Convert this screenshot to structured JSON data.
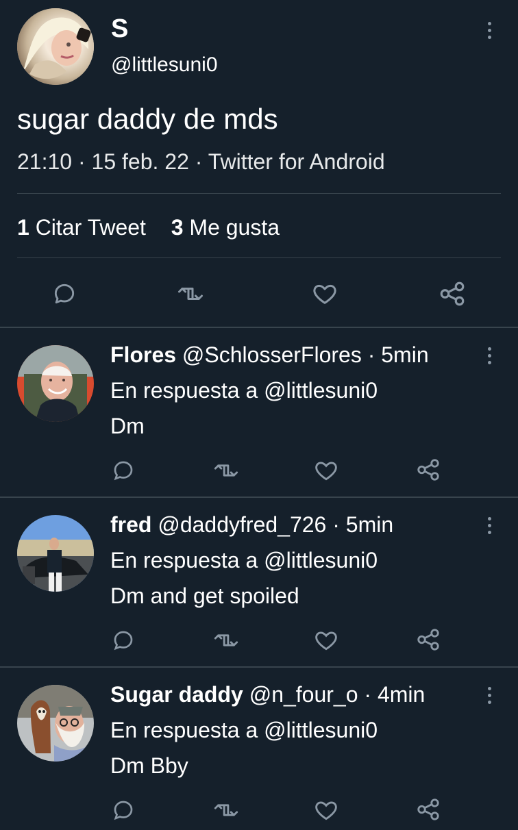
{
  "main_tweet": {
    "name": "S",
    "handle": "@littlesuni0",
    "text": "sugar daddy de mds",
    "meta": "21:10 · 15 feb. 22 · Twitter for Android",
    "stats": {
      "quote_count": "1",
      "quote_label": "Citar Tweet",
      "like_count": "3",
      "like_label": "Me gusta"
    }
  },
  "replies": [
    {
      "name": "Flores",
      "handle": "@SchlosserFlores",
      "time": "· 5min",
      "reply_to": "En respuesta a @littlesuni0",
      "text": "Dm"
    },
    {
      "name": "fred",
      "handle": "@daddyfred_726",
      "time": "· 5min",
      "reply_to": "En respuesta a @littlesuni0",
      "text": "Dm and get spoiled"
    },
    {
      "name": "Sugar daddy",
      "handle": "@n_four_o",
      "time": "· 4min",
      "reply_to": "En respuesta a @littlesuni0",
      "text": "Dm Bby"
    }
  ],
  "colors": {
    "background": "#15202b",
    "divider": "#38444d",
    "icon": "#8b98a5",
    "text": "#ffffff"
  },
  "icons": {
    "reply": "reply-icon",
    "retweet": "retweet-icon",
    "like": "heart-icon",
    "share": "share-icon",
    "more": "more-options-icon"
  }
}
